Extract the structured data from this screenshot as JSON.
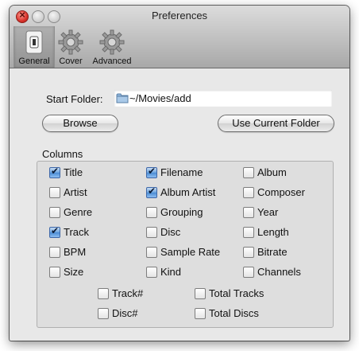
{
  "window": {
    "title": "Preferences",
    "controls": [
      "close-button",
      "minimize-button",
      "zoom-button"
    ]
  },
  "toolbar": {
    "items": [
      {
        "label": "General",
        "icon": "general-switch-icon",
        "selected": true
      },
      {
        "label": "Cover",
        "icon": "gear-icon",
        "selected": false
      },
      {
        "label": "Advanced",
        "icon": "gear-icon",
        "selected": false
      }
    ]
  },
  "start_folder": {
    "label": "Start Folder:",
    "value": "~/Movies/add",
    "icon": "folder-icon"
  },
  "buttons": {
    "browse": "Browse",
    "use_current": "Use Current Folder"
  },
  "columns": {
    "title": "Columns",
    "items": [
      {
        "label": "Title",
        "checked": true
      },
      {
        "label": "Filename",
        "checked": true
      },
      {
        "label": "Album",
        "checked": false
      },
      {
        "label": "Artist",
        "checked": false
      },
      {
        "label": "Album Artist",
        "checked": true
      },
      {
        "label": "Composer",
        "checked": false
      },
      {
        "label": "Genre",
        "checked": false
      },
      {
        "label": "Grouping",
        "checked": false
      },
      {
        "label": "Year",
        "checked": false
      },
      {
        "label": "Track",
        "checked": true
      },
      {
        "label": "Disc",
        "checked": false
      },
      {
        "label": "Length",
        "checked": false
      },
      {
        "label": "BPM",
        "checked": false
      },
      {
        "label": "Sample Rate",
        "checked": false
      },
      {
        "label": "Bitrate",
        "checked": false
      },
      {
        "label": "Size",
        "checked": false
      },
      {
        "label": "Kind",
        "checked": false
      },
      {
        "label": "Channels",
        "checked": false
      },
      {
        "label": "Track#",
        "checked": false
      },
      {
        "label": "Total Tracks",
        "checked": false
      },
      {
        "label": "Disc#",
        "checked": false
      },
      {
        "label": "Total Discs",
        "checked": false
      }
    ]
  }
}
